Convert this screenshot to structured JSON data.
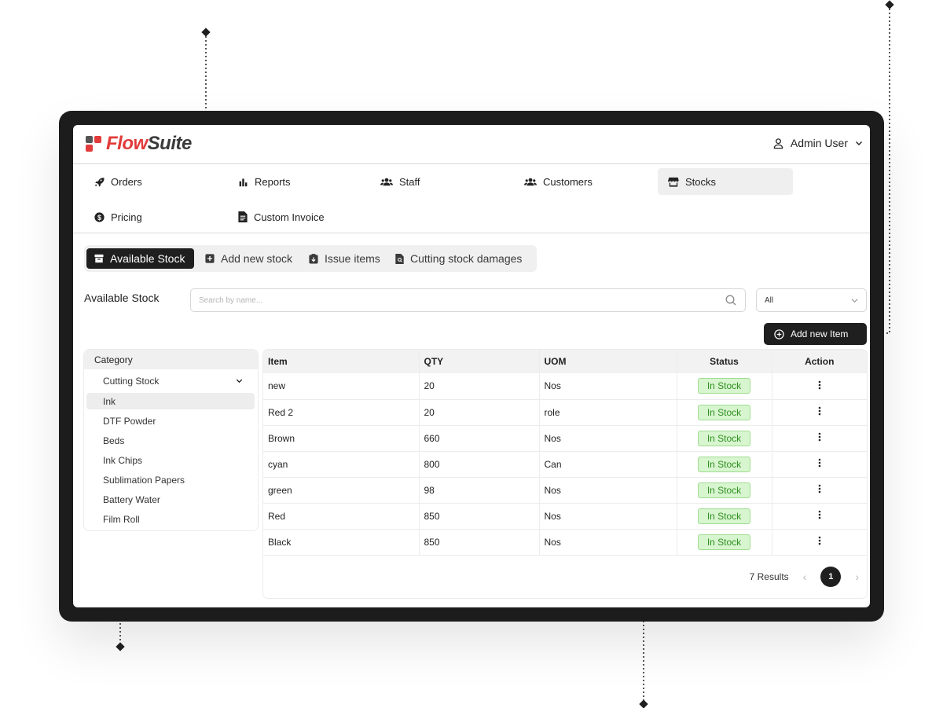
{
  "brand": {
    "name_part1": "Flow",
    "name_part2": "Suite"
  },
  "user": {
    "name": "Admin User",
    "icon": "user-icon"
  },
  "nav": {
    "items": [
      {
        "label": "Orders",
        "icon": "rocket-icon"
      },
      {
        "label": "Reports",
        "icon": "bar-chart-icon"
      },
      {
        "label": "Staff",
        "icon": "users-icon"
      },
      {
        "label": "Customers",
        "icon": "users-icon"
      },
      {
        "label": "Stocks",
        "icon": "store-icon",
        "active": true
      },
      {
        "label": "Pricing",
        "icon": "dollar-icon"
      },
      {
        "label": "Custom Invoice",
        "icon": "document-icon"
      }
    ]
  },
  "subtabs": [
    {
      "label": "Available Stock",
      "icon": "archive-icon",
      "active": true
    },
    {
      "label": "Add new stock",
      "icon": "plus-square-icon"
    },
    {
      "label": "Issue items",
      "icon": "issue-icon"
    },
    {
      "label": "Cutting stock damages",
      "icon": "damage-icon"
    }
  ],
  "page": {
    "title": "Available Stock"
  },
  "search": {
    "placeholder": "Search by name..."
  },
  "filter": {
    "selected": "All"
  },
  "add_button": {
    "label": "Add new Item"
  },
  "category": {
    "header": "Category",
    "group": "Cutting Stock",
    "items": [
      "Ink",
      "DTF Powder",
      "Beds",
      "Ink Chips",
      "Sublimation Papers",
      "Battery Water",
      "Film Roll"
    ],
    "selected": "Ink"
  },
  "table": {
    "columns": [
      "Item",
      "QTY",
      "UOM",
      "Status",
      "Action"
    ],
    "rows": [
      {
        "item": "new",
        "qty": "20",
        "uom": "Nos",
        "status": "In Stock"
      },
      {
        "item": "Red 2",
        "qty": "20",
        "uom": "role",
        "status": "In Stock"
      },
      {
        "item": "Brown",
        "qty": "660",
        "uom": "Nos",
        "status": "In Stock"
      },
      {
        "item": "cyan",
        "qty": "800",
        "uom": "Can",
        "status": "In Stock"
      },
      {
        "item": "green",
        "qty": "98",
        "uom": "Nos",
        "status": "In Stock"
      },
      {
        "item": "Red",
        "qty": "850",
        "uom": "Nos",
        "status": "In Stock"
      },
      {
        "item": "Black",
        "qty": "850",
        "uom": "Nos",
        "status": "In Stock"
      }
    ]
  },
  "pagination": {
    "results": "7 Results",
    "current_page": "1"
  },
  "colors": {
    "brand_red": "#e23b3b",
    "dark": "#1f1f1f",
    "status_green_bg": "#d7f5cf",
    "status_green_text": "#2f8f1f"
  }
}
